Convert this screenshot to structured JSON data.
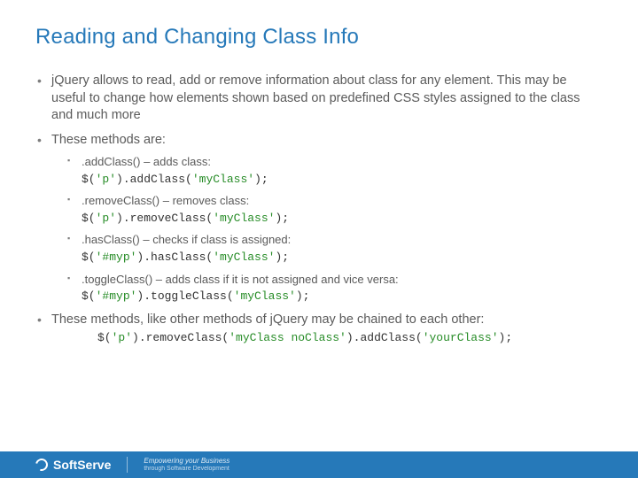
{
  "title": "Reading and Changing Class Info",
  "bullets": {
    "b1": "jQuery allows to read, add or remove information about class for any element. This may be useful to change how elements shown based on predefined CSS styles assigned to the class and much more",
    "b2": "These methods are:",
    "b3": "These methods, like other methods of jQuery may be chained to each other:"
  },
  "methods": {
    "m1_desc": ".addClass() – adds class:",
    "m1_pre": "$(",
    "m1_s1": "'p'",
    "m1_mid": ").addClass(",
    "m1_s2": "'myClass'",
    "m1_post": ");",
    "m2_desc": ".removeClass() – removes class:",
    "m2_pre": "$(",
    "m2_s1": "'p'",
    "m2_mid": ").removeClass(",
    "m2_s2": "'myClass'",
    "m2_post": ");",
    "m3_desc": ".hasClass() – checks if class is assigned:",
    "m3_pre": "$(",
    "m3_s1": "'#myp'",
    "m3_mid": ").hasClass(",
    "m3_s2": "'myClass'",
    "m3_post": ");",
    "m4_desc": ".toggleClass() – adds class if it is not assigned and vice versa:",
    "m4_pre": "$(",
    "m4_s1": "'#myp'",
    "m4_mid": ").toggleClass(",
    "m4_s2": "'myClass'",
    "m4_post": ");"
  },
  "chain": {
    "p1": "$(",
    "s1": "'p'",
    "p2": ").removeClass(",
    "s2": "'myClass noClass'",
    "p3": ").addClass(",
    "s3": "'yourClass'",
    "p4": ");"
  },
  "footer": {
    "brand": "SoftServe",
    "tag1": "Empowering your Business",
    "tag2": "through Software Development"
  }
}
